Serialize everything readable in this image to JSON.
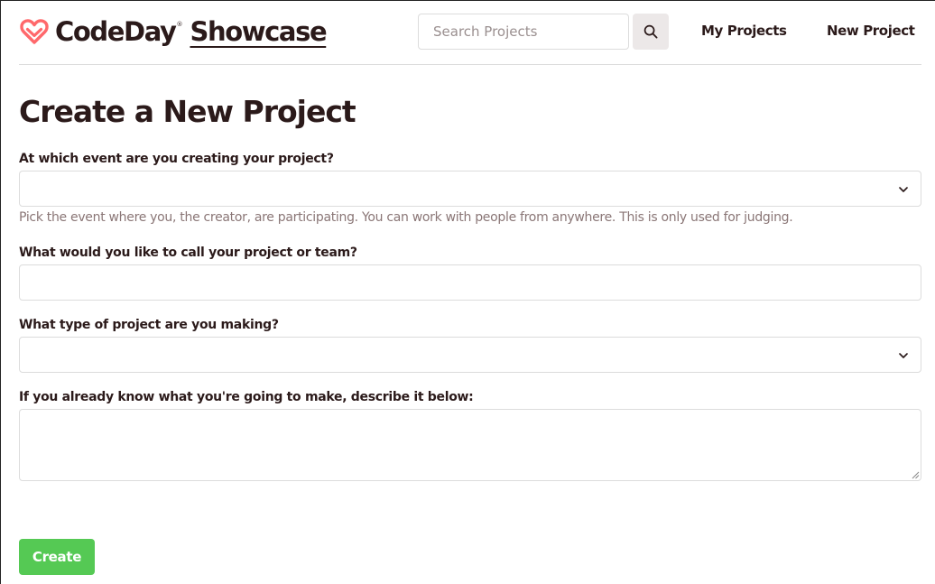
{
  "header": {
    "brand": "CodeDay",
    "registered_mark": "®",
    "product": "Showcase",
    "search_placeholder": "Search Projects",
    "nav": {
      "my_projects": "My Projects",
      "new_project": "New Project"
    }
  },
  "icons": {
    "logo": "heart-logo-icon",
    "search": "magnifier-search-icon",
    "select_arrow": "chevron-down-icon",
    "resize": "resize-grip-icon"
  },
  "colors": {
    "brand_red": "#ff686b",
    "text": "#2b1a1a",
    "help_text": "#8a7676",
    "create_button": "#55c954",
    "border": "#dcdcdc"
  },
  "main": {
    "title": "Create a New Project",
    "fields": {
      "event": {
        "label": "At which event are you creating your project?",
        "value": "",
        "help": "Pick the event where you, the creator, are participating. You can work with people from anywhere. This is only used for judging."
      },
      "name": {
        "label": "What would you like to call your project or team?",
        "value": ""
      },
      "type": {
        "label": "What type of project are you making?",
        "value": ""
      },
      "description": {
        "label": "If you already know what you're going to make, describe it below:",
        "value": ""
      }
    },
    "submit_label": "Create"
  }
}
